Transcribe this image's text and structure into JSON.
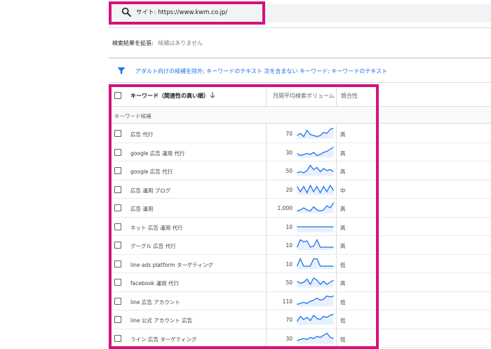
{
  "search": {
    "text": "サイト: https://www.kwm.co.jp/"
  },
  "expand": {
    "label": "検索結果を拡張:",
    "value": "候補はありません"
  },
  "filter": {
    "text": "アダルト向けの候補を除外; キーワードのテキスト 次を含まない キーワード; キーワードのテキスト"
  },
  "table": {
    "headers": {
      "keyword": "キーワード（関連性の高い順）",
      "volume": "月間平均検索ボリューム",
      "competition": "競合性"
    },
    "group_label": "キーワード候補",
    "rows": [
      {
        "keyword": "広告 代行",
        "volume": "70",
        "competition": "高",
        "trend": [
          3,
          5,
          2,
          8,
          4,
          3,
          2,
          3,
          6,
          5,
          9,
          10
        ]
      },
      {
        "keyword": "google 広告 運用 代行",
        "volume": "30",
        "competition": "高",
        "trend": [
          4,
          2,
          3,
          4,
          3,
          5,
          2,
          3,
          5,
          6,
          8,
          10
        ]
      },
      {
        "keyword": "google 広告 代行",
        "volume": "50",
        "competition": "高",
        "trend": [
          3,
          4,
          3,
          5,
          10,
          6,
          8,
          4,
          7,
          5,
          6,
          4
        ]
      },
      {
        "keyword": "広告 運用 ブログ",
        "volume": "20",
        "competition": "中",
        "trend": [
          8,
          3,
          8,
          2,
          9,
          3,
          8,
          2,
          8,
          3,
          9,
          4
        ]
      },
      {
        "keyword": "広告 運用",
        "volume": "1,000",
        "competition": "高",
        "trend": [
          2,
          3,
          5,
          3,
          2,
          6,
          3,
          2,
          3,
          7,
          5,
          10
        ]
      },
      {
        "keyword": "ネット 広告 運用 代行",
        "volume": "10",
        "competition": "高",
        "trend": [
          5,
          5,
          5,
          5,
          5,
          5,
          5,
          5,
          5,
          5,
          5,
          5
        ]
      },
      {
        "keyword": "グーグル 広告 代行",
        "volume": "10",
        "competition": "高",
        "trend": [
          3,
          10,
          8,
          9,
          3,
          4,
          10,
          3,
          3,
          3,
          3,
          3
        ]
      },
      {
        "keyword": "line ads platform ターゲティング",
        "volume": "10",
        "competition": "低",
        "trend": [
          3,
          10,
          3,
          3,
          3,
          10,
          10,
          3,
          3,
          3,
          3,
          3
        ]
      },
      {
        "keyword": "facebook 運用 代行",
        "volume": "50",
        "competition": "高",
        "trend": [
          6,
          4,
          5,
          8,
          3,
          9,
          7,
          3,
          6,
          3,
          5,
          7
        ]
      },
      {
        "keyword": "line 広告 アカウント",
        "volume": "110",
        "competition": "低",
        "trend": [
          2,
          3,
          4,
          3,
          5,
          6,
          8,
          6,
          7,
          10,
          9,
          10
        ]
      },
      {
        "keyword": "line 公式 アカウント 広告",
        "volume": "70",
        "competition": "低",
        "trend": [
          3,
          8,
          5,
          7,
          4,
          9,
          6,
          5,
          8,
          7,
          9,
          10
        ]
      },
      {
        "keyword": "ライン 広告 ターゲティング",
        "volume": "30",
        "competition": "低",
        "trend": [
          3,
          4,
          5,
          4,
          6,
          5,
          7,
          6,
          8,
          10,
          6,
          5
        ]
      }
    ]
  },
  "colors": {
    "highlight": "#d6127a",
    "accent": "#1a73e8",
    "spark_fill": "#e8f0fe"
  },
  "icons": {
    "search": "search-icon",
    "filter": "filter-icon",
    "sort": "arrow-down-icon",
    "checkbox": "checkbox-icon"
  }
}
